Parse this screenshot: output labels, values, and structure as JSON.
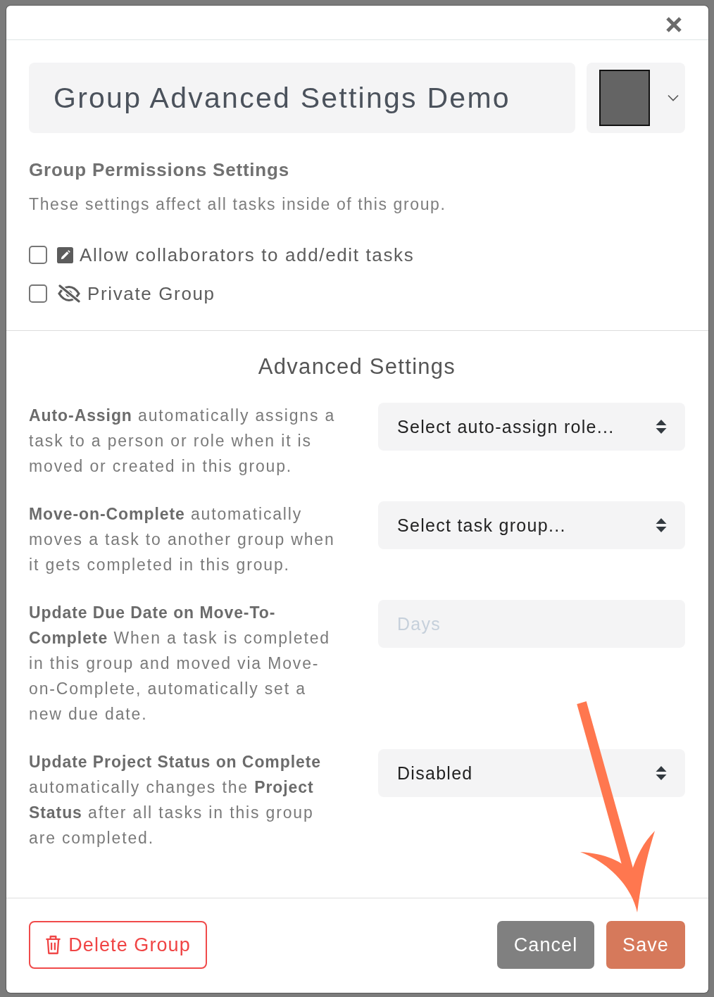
{
  "dialog": {
    "title_field": {
      "value": "Group Advanced Settings Demo"
    },
    "color_picker": {
      "color": "#646464"
    }
  },
  "permissions": {
    "heading": "Group Permissions Settings",
    "description": "These settings affect all tasks inside of this group.",
    "options": [
      {
        "label": "Allow collaborators to add/edit tasks",
        "checked": false
      },
      {
        "label": "Private Group",
        "checked": false
      }
    ]
  },
  "advanced": {
    "heading": "Advanced Settings",
    "settings": [
      {
        "kind": "select",
        "description": "**Auto-Assign** automatically assigns a task to a person or role when it is moved or created in this group.",
        "value": "Select auto-assign role..."
      },
      {
        "kind": "select",
        "description": "**Move-on-Complete** automatically moves a task to another group when it gets completed in this group.",
        "value": "Select task group..."
      },
      {
        "kind": "input",
        "description": "**Update Due Date on Move-To-Complete** When a task is completed in this group and moved via Move-on-Complete, automatically set a new due date.",
        "placeholder": "Days"
      },
      {
        "kind": "select",
        "description": "**Update Project Status on Complete** automatically changes the **Project Status** after all tasks in this group are completed.",
        "value": "Disabled"
      }
    ]
  },
  "footer": {
    "delete_button": "Delete Group",
    "cancel_button": "Cancel",
    "save_button": "Save"
  }
}
